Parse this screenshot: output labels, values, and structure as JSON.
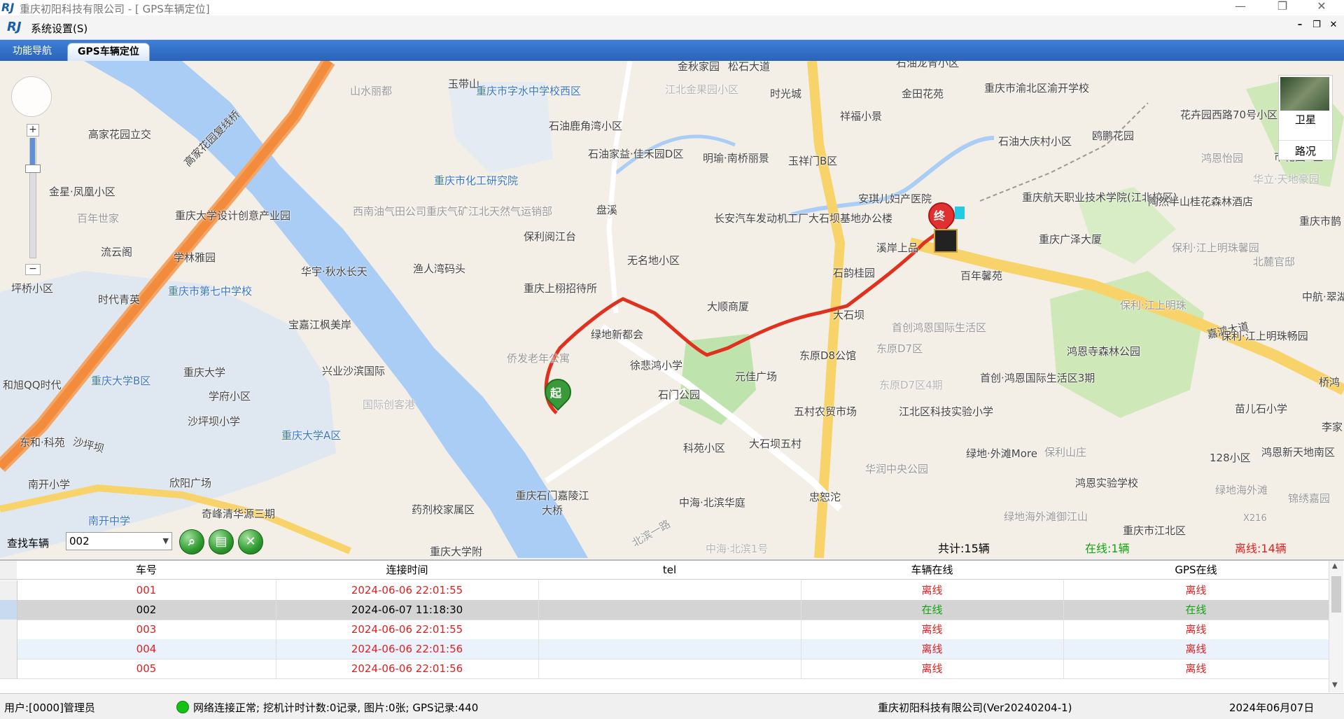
{
  "window": {
    "title": "重庆初阳科技有限公司 - [ GPS车辆定位]",
    "logo": "RJ"
  },
  "menu": {
    "system_settings": "系统设置(S)"
  },
  "tabs": {
    "nav": "功能导航",
    "gps": "GPS车辆定位"
  },
  "map": {
    "type_satellite": "卫星",
    "type_traffic": "路况",
    "marker_start": "起",
    "marker_end": "终",
    "labels": [
      "金秋家园",
      "松石大道",
      "玉带山",
      "石油龙青小区",
      "山水丽都",
      "重庆市字水中学校西区",
      "江北金果园小区",
      "时光城",
      "金田花苑",
      "重庆市渝北区渝开学校",
      "花卉园西路70号小区",
      "高家花园立交",
      "高家花园复线桥",
      "石油鹿角湾小区",
      "石油家益·佳禾园D区",
      "明瑜·南桥丽景",
      "玉祥门B区",
      "石油大庆村小区",
      "鸥鹏花园",
      "鸿恩怡园",
      "市花园B区",
      "祥福小景",
      "金星·凤凰小区",
      "重庆市化工研究院",
      "安琪儿妇产医院",
      "重庆航天职业技术学院(江北校区)",
      "陶然半山桂花森林酒店",
      "华立·天地豪园",
      "重庆大学设计创意产业园",
      "百年世家",
      "西南油气田公司重庆气矿江北天然气运销部",
      "盘溪",
      "长安汽车发动机工厂大石坝基地办公楼",
      "重庆广泽大厦",
      "重庆市鹊",
      "流云阁",
      "学林雅园",
      "保利阅江台",
      "无名地小区",
      "溪岸上品",
      "百年馨苑",
      "保利·江上明珠馨园",
      "北麓官邸",
      "华宇·秋水长天",
      "渔人湾码头",
      "石韵桂园",
      "坪桥小区",
      "时代青英",
      "重庆市第七中学校",
      "重庆上栩招待所",
      "大顺商厦",
      "大石坝",
      "首创鸿恩国际生活区",
      "保利·江上明珠",
      "中航·翠湖",
      "宝嘉江枫美岸",
      "绿地新都会",
      "嘉鸿大道",
      "东原D8公馆",
      "东原D7区",
      "保利·江上明珠畅园",
      "鸿恩寺森林公园",
      "兴业沙滨国际",
      "侨发老年公寓",
      "重庆大学",
      "徐悲鸿小学",
      "元佳广场",
      "东原D7区4期",
      "首创·鸿恩国际生活区3期",
      "桥鸿",
      "和旭QQ时代",
      "重庆大学B区",
      "学府小区",
      "石门公园",
      "苗儿石小学",
      "沙坪坝小学",
      "国际创客港",
      "五村农贸市场",
      "江北区科技实验小学",
      "李家",
      "东和·科苑",
      "沙坪坝",
      "重庆大学A区",
      "科苑小区",
      "大石坝五村",
      "绿地·外滩More",
      "保利山庄",
      "128小区",
      "鸿恩新天地南区",
      "南开小学",
      "欣阳广场",
      "华润中央公园",
      "鸿恩实验学校",
      "绿地海外滩",
      "奇峰清华源三期",
      "药剂校家属区",
      "重庆石门嘉陵江大桥",
      "中海·北滨华庭",
      "忠恕沱",
      "绿地海外滩御江山",
      "锦绣嘉园",
      "南开中学",
      "重庆大学附",
      "北滨一路",
      "中海·北滨1号",
      "重庆市江北区",
      "X216"
    ]
  },
  "search": {
    "label": "查找车辆",
    "value": "002",
    "search_icon": "search-icon",
    "list_icon": "document-icon",
    "clear_icon": "close-icon"
  },
  "counts": {
    "total": "共计:15辆",
    "online": "在线:1辆",
    "offline": "离线:14辆"
  },
  "grid": {
    "columns": [
      "车号",
      "连接时间",
      "tel",
      "车辆在线",
      "GPS在线"
    ],
    "rows": [
      {
        "no": "001",
        "time": "2024-06-06 22:01:55",
        "tel": "",
        "vehicle": "离线",
        "gps": "离线"
      },
      {
        "no": "002",
        "time": "2024-06-07 11:18:30",
        "tel": "",
        "vehicle": "在线",
        "gps": "在线"
      },
      {
        "no": "003",
        "time": "2024-06-06 22:01:55",
        "tel": "",
        "vehicle": "离线",
        "gps": "离线"
      },
      {
        "no": "004",
        "time": "2024-06-06 22:01:56",
        "tel": "",
        "vehicle": "离线",
        "gps": "离线"
      },
      {
        "no": "005",
        "time": "2024-06-06 22:01:56",
        "tel": "",
        "vehicle": "离线",
        "gps": "离线"
      }
    ]
  },
  "status": {
    "user": "用户:[0000]管理员",
    "network": "网络连接正常; 挖机计时计数:0记录, 图片:0张; GPS记录:440",
    "company": "重庆初阳科技有限公司(Ver20240204-1)",
    "date": "2024年06月07日"
  },
  "colors": {
    "route": "#e0301e",
    "online": "#13a313",
    "offline": "#e02020",
    "tab_blue": "#2b63b8",
    "river": "#a9cdf5"
  }
}
